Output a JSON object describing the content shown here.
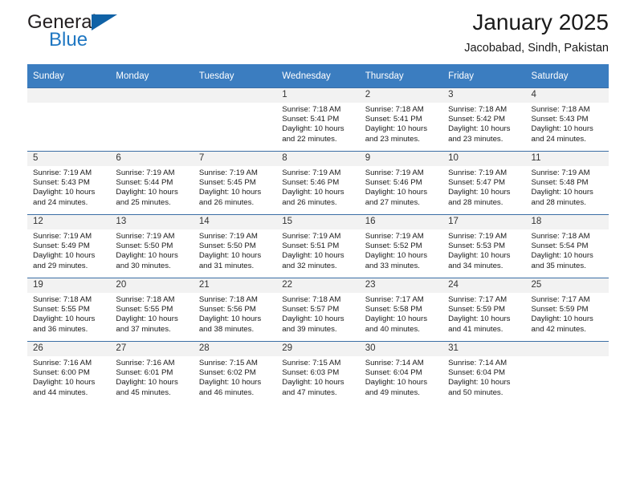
{
  "brand": {
    "name_top": "General",
    "name_bottom": "Blue",
    "triangle_icon": "triangle-icon"
  },
  "header": {
    "title": "January 2025",
    "location": "Jacobabad, Sindh, Pakistan"
  },
  "colors": {
    "header_blue": "#3b7dc0",
    "brand_blue": "#1f77c2",
    "daynum_strip": "#f2f2f2",
    "row_border": "#3b6ea5"
  },
  "calendar": {
    "weekdays": [
      "Sunday",
      "Monday",
      "Tuesday",
      "Wednesday",
      "Thursday",
      "Friday",
      "Saturday"
    ],
    "weeks": [
      [
        {
          "day": "",
          "sunrise": "",
          "sunset": "",
          "daylight_line1": "",
          "daylight_line2": ""
        },
        {
          "day": "",
          "sunrise": "",
          "sunset": "",
          "daylight_line1": "",
          "daylight_line2": ""
        },
        {
          "day": "",
          "sunrise": "",
          "sunset": "",
          "daylight_line1": "",
          "daylight_line2": ""
        },
        {
          "day": "1",
          "sunrise": "Sunrise: 7:18 AM",
          "sunset": "Sunset: 5:41 PM",
          "daylight_line1": "Daylight: 10 hours",
          "daylight_line2": "and 22 minutes."
        },
        {
          "day": "2",
          "sunrise": "Sunrise: 7:18 AM",
          "sunset": "Sunset: 5:41 PM",
          "daylight_line1": "Daylight: 10 hours",
          "daylight_line2": "and 23 minutes."
        },
        {
          "day": "3",
          "sunrise": "Sunrise: 7:18 AM",
          "sunset": "Sunset: 5:42 PM",
          "daylight_line1": "Daylight: 10 hours",
          "daylight_line2": "and 23 minutes."
        },
        {
          "day": "4",
          "sunrise": "Sunrise: 7:18 AM",
          "sunset": "Sunset: 5:43 PM",
          "daylight_line1": "Daylight: 10 hours",
          "daylight_line2": "and 24 minutes."
        }
      ],
      [
        {
          "day": "5",
          "sunrise": "Sunrise: 7:19 AM",
          "sunset": "Sunset: 5:43 PM",
          "daylight_line1": "Daylight: 10 hours",
          "daylight_line2": "and 24 minutes."
        },
        {
          "day": "6",
          "sunrise": "Sunrise: 7:19 AM",
          "sunset": "Sunset: 5:44 PM",
          "daylight_line1": "Daylight: 10 hours",
          "daylight_line2": "and 25 minutes."
        },
        {
          "day": "7",
          "sunrise": "Sunrise: 7:19 AM",
          "sunset": "Sunset: 5:45 PM",
          "daylight_line1": "Daylight: 10 hours",
          "daylight_line2": "and 26 minutes."
        },
        {
          "day": "8",
          "sunrise": "Sunrise: 7:19 AM",
          "sunset": "Sunset: 5:46 PM",
          "daylight_line1": "Daylight: 10 hours",
          "daylight_line2": "and 26 minutes."
        },
        {
          "day": "9",
          "sunrise": "Sunrise: 7:19 AM",
          "sunset": "Sunset: 5:46 PM",
          "daylight_line1": "Daylight: 10 hours",
          "daylight_line2": "and 27 minutes."
        },
        {
          "day": "10",
          "sunrise": "Sunrise: 7:19 AM",
          "sunset": "Sunset: 5:47 PM",
          "daylight_line1": "Daylight: 10 hours",
          "daylight_line2": "and 28 minutes."
        },
        {
          "day": "11",
          "sunrise": "Sunrise: 7:19 AM",
          "sunset": "Sunset: 5:48 PM",
          "daylight_line1": "Daylight: 10 hours",
          "daylight_line2": "and 28 minutes."
        }
      ],
      [
        {
          "day": "12",
          "sunrise": "Sunrise: 7:19 AM",
          "sunset": "Sunset: 5:49 PM",
          "daylight_line1": "Daylight: 10 hours",
          "daylight_line2": "and 29 minutes."
        },
        {
          "day": "13",
          "sunrise": "Sunrise: 7:19 AM",
          "sunset": "Sunset: 5:50 PM",
          "daylight_line1": "Daylight: 10 hours",
          "daylight_line2": "and 30 minutes."
        },
        {
          "day": "14",
          "sunrise": "Sunrise: 7:19 AM",
          "sunset": "Sunset: 5:50 PM",
          "daylight_line1": "Daylight: 10 hours",
          "daylight_line2": "and 31 minutes."
        },
        {
          "day": "15",
          "sunrise": "Sunrise: 7:19 AM",
          "sunset": "Sunset: 5:51 PM",
          "daylight_line1": "Daylight: 10 hours",
          "daylight_line2": "and 32 minutes."
        },
        {
          "day": "16",
          "sunrise": "Sunrise: 7:19 AM",
          "sunset": "Sunset: 5:52 PM",
          "daylight_line1": "Daylight: 10 hours",
          "daylight_line2": "and 33 minutes."
        },
        {
          "day": "17",
          "sunrise": "Sunrise: 7:19 AM",
          "sunset": "Sunset: 5:53 PM",
          "daylight_line1": "Daylight: 10 hours",
          "daylight_line2": "and 34 minutes."
        },
        {
          "day": "18",
          "sunrise": "Sunrise: 7:18 AM",
          "sunset": "Sunset: 5:54 PM",
          "daylight_line1": "Daylight: 10 hours",
          "daylight_line2": "and 35 minutes."
        }
      ],
      [
        {
          "day": "19",
          "sunrise": "Sunrise: 7:18 AM",
          "sunset": "Sunset: 5:55 PM",
          "daylight_line1": "Daylight: 10 hours",
          "daylight_line2": "and 36 minutes."
        },
        {
          "day": "20",
          "sunrise": "Sunrise: 7:18 AM",
          "sunset": "Sunset: 5:55 PM",
          "daylight_line1": "Daylight: 10 hours",
          "daylight_line2": "and 37 minutes."
        },
        {
          "day": "21",
          "sunrise": "Sunrise: 7:18 AM",
          "sunset": "Sunset: 5:56 PM",
          "daylight_line1": "Daylight: 10 hours",
          "daylight_line2": "and 38 minutes."
        },
        {
          "day": "22",
          "sunrise": "Sunrise: 7:18 AM",
          "sunset": "Sunset: 5:57 PM",
          "daylight_line1": "Daylight: 10 hours",
          "daylight_line2": "and 39 minutes."
        },
        {
          "day": "23",
          "sunrise": "Sunrise: 7:17 AM",
          "sunset": "Sunset: 5:58 PM",
          "daylight_line1": "Daylight: 10 hours",
          "daylight_line2": "and 40 minutes."
        },
        {
          "day": "24",
          "sunrise": "Sunrise: 7:17 AM",
          "sunset": "Sunset: 5:59 PM",
          "daylight_line1": "Daylight: 10 hours",
          "daylight_line2": "and 41 minutes."
        },
        {
          "day": "25",
          "sunrise": "Sunrise: 7:17 AM",
          "sunset": "Sunset: 5:59 PM",
          "daylight_line1": "Daylight: 10 hours",
          "daylight_line2": "and 42 minutes."
        }
      ],
      [
        {
          "day": "26",
          "sunrise": "Sunrise: 7:16 AM",
          "sunset": "Sunset: 6:00 PM",
          "daylight_line1": "Daylight: 10 hours",
          "daylight_line2": "and 44 minutes."
        },
        {
          "day": "27",
          "sunrise": "Sunrise: 7:16 AM",
          "sunset": "Sunset: 6:01 PM",
          "daylight_line1": "Daylight: 10 hours",
          "daylight_line2": "and 45 minutes."
        },
        {
          "day": "28",
          "sunrise": "Sunrise: 7:15 AM",
          "sunset": "Sunset: 6:02 PM",
          "daylight_line1": "Daylight: 10 hours",
          "daylight_line2": "and 46 minutes."
        },
        {
          "day": "29",
          "sunrise": "Sunrise: 7:15 AM",
          "sunset": "Sunset: 6:03 PM",
          "daylight_line1": "Daylight: 10 hours",
          "daylight_line2": "and 47 minutes."
        },
        {
          "day": "30",
          "sunrise": "Sunrise: 7:14 AM",
          "sunset": "Sunset: 6:04 PM",
          "daylight_line1": "Daylight: 10 hours",
          "daylight_line2": "and 49 minutes."
        },
        {
          "day": "31",
          "sunrise": "Sunrise: 7:14 AM",
          "sunset": "Sunset: 6:04 PM",
          "daylight_line1": "Daylight: 10 hours",
          "daylight_line2": "and 50 minutes."
        },
        {
          "day": "",
          "sunrise": "",
          "sunset": "",
          "daylight_line1": "",
          "daylight_line2": ""
        }
      ]
    ]
  }
}
